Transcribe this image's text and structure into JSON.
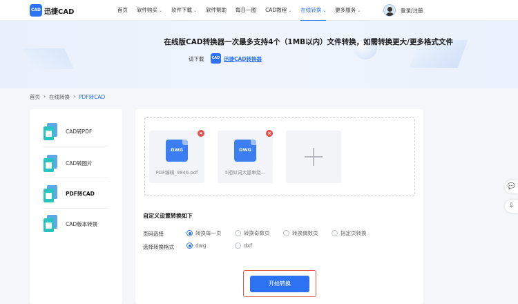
{
  "header": {
    "logo_badge": "CAD",
    "logo_text": "迅捷CAD",
    "nav": [
      {
        "label": "首页",
        "chevron": false
      },
      {
        "label": "软件购买",
        "chevron": true
      },
      {
        "label": "软件下载",
        "chevron": true
      },
      {
        "label": "软件帮助",
        "chevron": false
      },
      {
        "label": "每日一图",
        "chevron": false
      },
      {
        "label": "CAD教程",
        "chevron": true
      },
      {
        "label": "在线转换",
        "chevron": true,
        "active": true
      },
      {
        "label": "更多服务",
        "chevron": true
      }
    ],
    "chevron_glyph": "⌄",
    "login_label": "登录/注册"
  },
  "banner": {
    "title": "在线版CAD转换器一次最多支持4个（1MB以内）文件转换，如需转换更大/更多格式文件",
    "download_label": "请下载",
    "download_icon_text": "CAD",
    "download_link": "迅捷CAD转换器"
  },
  "breadcrumb": {
    "items": [
      "首页",
      "在线转换",
      "PDF转CAD"
    ],
    "separator": "›"
  },
  "sidebar": {
    "items": [
      {
        "label": "CAD转PDF",
        "active": false
      },
      {
        "label": "CAD转图片",
        "active": false
      },
      {
        "label": "PDF转CAD",
        "active": true
      },
      {
        "label": "CAD版本转换",
        "active": false
      }
    ]
  },
  "upload": {
    "files": [
      {
        "badge": "DWG",
        "name": "PDF编辑_9846.pdf"
      },
      {
        "badge": "DWG",
        "name": "5相似词大量串烧..."
      }
    ],
    "remove_glyph": "×"
  },
  "settings": {
    "title": "自定义设置转换如下",
    "page_label": "页码选择",
    "page_options": [
      {
        "label": "转换每一页",
        "selected": true
      },
      {
        "label": "转换奇数页",
        "selected": false
      },
      {
        "label": "转换偶数页",
        "selected": false
      },
      {
        "label": "指定页转换",
        "selected": false
      }
    ],
    "format_label": "选择转换格式",
    "format_options": [
      {
        "label": "dwg",
        "selected": true
      },
      {
        "label": "dxf",
        "selected": false
      }
    ]
  },
  "actions": {
    "start_label": "开始转换"
  },
  "floating": {
    "chat_glyph": "💬",
    "download_glyph": "⇩"
  },
  "colors": {
    "accent": "#2d72f0",
    "remove": "#e84b4b",
    "highlight_outline": "#e05a4a",
    "file_tile": "#3a7ef2",
    "sidebar_icon": "#27c4c0"
  }
}
